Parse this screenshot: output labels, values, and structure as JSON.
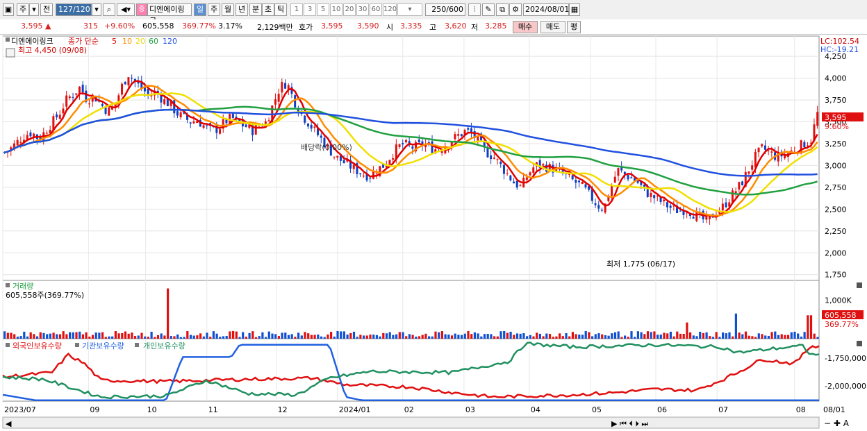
{
  "toolbar": {
    "tabs": [
      "주",
      "전"
    ],
    "period_input": "127/120",
    "stock_name": "디엔에이링크",
    "stock_badge": "증",
    "timeframes": [
      "일",
      "주",
      "월",
      "년",
      "분",
      "초",
      "틱"
    ],
    "minute_options": [
      "1",
      "3",
      "5",
      "10",
      "20",
      "30",
      "60",
      "120"
    ],
    "count": "250",
    "count_max": "/600",
    "date": "2024/08/01"
  },
  "quote": {
    "price": "3,595 ▲",
    "change": "315",
    "change_pct": "+9.60%",
    "volume": "605,558",
    "vol_ratio": "369.77%",
    "turnover": "3.17%",
    "value": "2,129백만",
    "ask_label": "호가",
    "ask": "3,595",
    "bid": "3,590",
    "open_label": "시",
    "open": "3,335",
    "high_label": "고",
    "high": "3,620",
    "low_label": "저",
    "low": "3,285",
    "buy_btn": "매수",
    "sell_btn": "매도",
    "eval_btn": "평"
  },
  "price_panel": {
    "legend_name": "디엔에이링크",
    "legend_ma": "종가 단순",
    "ma_periods": [
      "5",
      "10",
      "20",
      "60",
      "120"
    ],
    "ma_colors": [
      "#e00000",
      "#ff8c00",
      "#f0e000",
      "#20a040",
      "#2050e0"
    ],
    "high_note": "최고 4,450 (09/08)",
    "low_note": "최저 1,775 (06/17)",
    "dividend_note": "배당락(0.00%)",
    "lc": "LC:102.54",
    "hc": "HC:-19.21",
    "last_price_tag": "3,595",
    "last_pct_tag": "9.60%"
  },
  "volume_panel": {
    "title": "거래량",
    "value": "605,558주(369.77%)",
    "tag": "605,558",
    "tag_pct": "369.77%"
  },
  "holding_panel": {
    "labels": [
      "외국인보유수량",
      "기관보유수량",
      "개인보유수량"
    ],
    "colors": [
      "#e01010",
      "#2060e0",
      "#209060"
    ]
  },
  "chart_data": [
    {
      "type": "candlestick",
      "title": "디엔에이링크",
      "ylim": [
        1700,
        4450
      ],
      "yticks": [
        1750,
        2000,
        2250,
        2500,
        2750,
        3000,
        3250,
        3500,
        3750,
        4000,
        4250
      ],
      "ytick_labels": [
        "1,750",
        "2,000",
        "2,250",
        "2,500",
        "2,750",
        "3,000",
        "3,250",
        "3,500",
        "3,750",
        "4,000",
        "4,250"
      ],
      "x_labels": [
        "2023/07",
        "09",
        "10",
        "11",
        "12",
        "2024/01",
        "02",
        "03",
        "04",
        "05",
        "06",
        "07",
        "08",
        "08/01"
      ],
      "close_path": [
        3150,
        3200,
        3280,
        3350,
        3380,
        3300,
        3400,
        3500,
        3600,
        3750,
        3820,
        3900,
        3750,
        3800,
        3700,
        3620,
        3680,
        3900,
        4050,
        3950,
        3880,
        3800,
        3850,
        3750,
        3700,
        3600,
        3550,
        3500,
        3520,
        3450,
        3400,
        3420,
        3500,
        3550,
        3480,
        3450,
        3400,
        3450,
        3500,
        3700,
        3900,
        3950,
        3750,
        3600,
        3500,
        3400,
        3300,
        3200,
        3100,
        3050,
        3000,
        2950,
        2900,
        2880,
        2950,
        3000,
        3100,
        3200,
        3250,
        3200,
        3220,
        3250,
        3200,
        3180,
        3230,
        3300,
        3350,
        3400,
        3350,
        3250,
        3150,
        3100,
        3000,
        2900,
        2800,
        2750,
        2900,
        3000,
        3000,
        2980,
        2950,
        2900,
        2850,
        2800,
        2750,
        2650,
        2550,
        2500,
        2750,
        2950,
        2900,
        2850,
        2800,
        2700,
        2650,
        2600,
        2550,
        2500,
        2480,
        2500,
        2450,
        2400,
        2350,
        2450,
        2500,
        2600,
        2700,
        2800,
        2950,
        3100,
        3200,
        3150,
        3100,
        3120,
        3150,
        3200,
        3250,
        3280,
        3595
      ],
      "ma_series": [
        {
          "name": "5",
          "color": "#e00000"
        },
        {
          "name": "10",
          "color": "#ff8c00"
        },
        {
          "name": "20",
          "color": "#f0e000"
        },
        {
          "name": "60",
          "color": "#20a040"
        },
        {
          "name": "120",
          "color": "#2050e0"
        }
      ]
    },
    {
      "type": "bar",
      "title": "거래량",
      "yticks": [
        1000000
      ],
      "ytick_labels": [
        "1,000K"
      ],
      "spikes": [
        {
          "at": 0.2,
          "value": 1300000
        },
        {
          "at": 0.84,
          "value": 420000
        },
        {
          "at": 0.9,
          "value": 650000
        },
        {
          "at": 0.99,
          "value": 605558
        }
      ]
    },
    {
      "type": "line",
      "title": "보유수량",
      "yticks": [
        -1750000,
        -2000000
      ],
      "ytick_labels": [
        "-1,750,000",
        "-2,000,000"
      ],
      "series": [
        {
          "name": "외국인보유수량",
          "color": "#e01010"
        },
        {
          "name": "기관보유수량",
          "color": "#2060e0"
        },
        {
          "name": "개인보유수량",
          "color": "#209060"
        }
      ]
    }
  ]
}
